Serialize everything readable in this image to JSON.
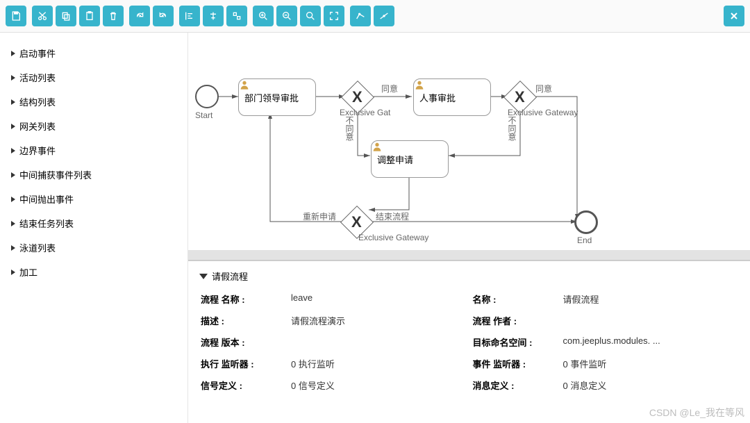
{
  "sidebar": {
    "items": [
      {
        "label": "启动事件"
      },
      {
        "label": "活动列表"
      },
      {
        "label": "结构列表"
      },
      {
        "label": "网关列表"
      },
      {
        "label": "边界事件"
      },
      {
        "label": "中间捕获事件列表"
      },
      {
        "label": "中间抛出事件"
      },
      {
        "label": "结束任务列表"
      },
      {
        "label": "泳道列表"
      },
      {
        "label": "加工"
      }
    ]
  },
  "diagram": {
    "start": {
      "label": "Start"
    },
    "end": {
      "label": "End"
    },
    "task1": {
      "label": "部门领导审批"
    },
    "task2": {
      "label": "人事审批"
    },
    "task3": {
      "label": "调整申请"
    },
    "gw1": {
      "label": "Exclusive Gateway",
      "short": "Exclusive Gat"
    },
    "gw2": {
      "label": "Exclusive Gateway"
    },
    "gw3": {
      "label": "Exclusive Gateway"
    },
    "edge_agree": "同意",
    "edge_disagree": "不同意",
    "edge_resubmit": "重新申请",
    "edge_end": "结束流程"
  },
  "props": {
    "title": "请假流程",
    "rows": [
      {
        "l1": "流程 名称  :",
        "v1": "leave",
        "l2": "名称  :",
        "v2": "请假流程"
      },
      {
        "l1": "描述  :",
        "v1": "请假流程演示",
        "l2": "流程 作者  :",
        "v2": ""
      },
      {
        "l1": "流程 版本  :",
        "v1": "",
        "l2": "目标命名空间  :",
        "v2": "com.jeeplus.modules. ..."
      },
      {
        "l1": "执行 监听器  :",
        "v1": "0 执行监听",
        "l2": "事件 监听器  :",
        "v2": "0 事件监听"
      },
      {
        "l1": "信号定义  :",
        "v1": "0 信号定义",
        "l2": "消息定义  :",
        "v2": "0 消息定义"
      }
    ]
  },
  "watermark": "CSDN @Le_我在等风"
}
